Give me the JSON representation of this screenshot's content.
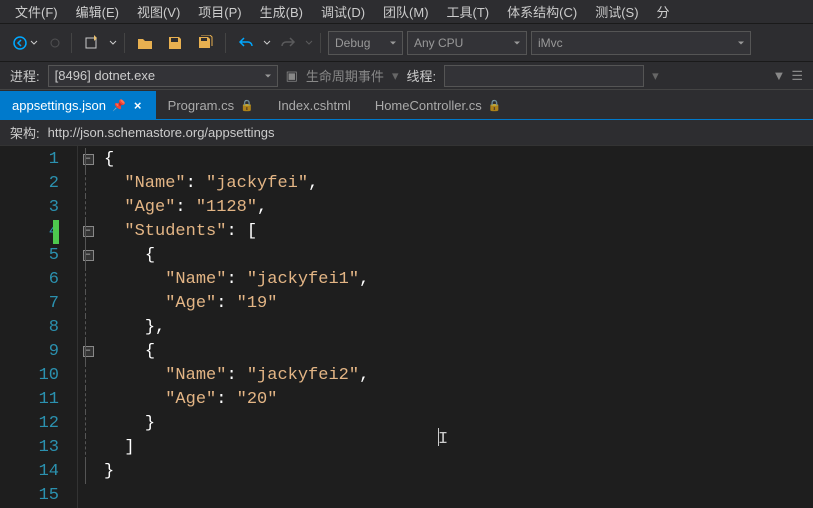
{
  "menu": {
    "items": [
      "文件(F)",
      "编辑(E)",
      "视图(V)",
      "项目(P)",
      "生成(B)",
      "调试(D)",
      "团队(M)",
      "工具(T)",
      "体系结构(C)",
      "测试(S)",
      "分"
    ]
  },
  "toolbar": {
    "config_label": "Debug",
    "platform_label": "Any CPU",
    "project_label": "iMvc"
  },
  "process": {
    "label": "进程:",
    "selected": "[8496] dotnet.exe",
    "lifecycle_label": "生命周期事件",
    "thread_label": "线程:"
  },
  "tabs": {
    "items": [
      {
        "label": "appsettings.json",
        "active": true,
        "pin": true,
        "close": true
      },
      {
        "label": "Program.cs",
        "active": false,
        "lock": true
      },
      {
        "label": "Index.cshtml",
        "active": false
      },
      {
        "label": "HomeController.cs",
        "active": false,
        "lock": true
      }
    ]
  },
  "schema": {
    "label": "架构:",
    "url": "http://json.schemastore.org/appsettings"
  },
  "code": {
    "lines": [
      "{",
      "  \"Name\": \"jackyfei\",",
      "  \"Age\": \"1128\",",
      "  \"Students\": [",
      "    {",
      "      \"Name\": \"jackyfei1\",",
      "      \"Age\": \"19\"",
      "    },",
      "    {",
      "      \"Name\": \"jackyfei2\",",
      "      \"Age\": \"20\"",
      "    }",
      "  ]",
      "}",
      ""
    ]
  }
}
